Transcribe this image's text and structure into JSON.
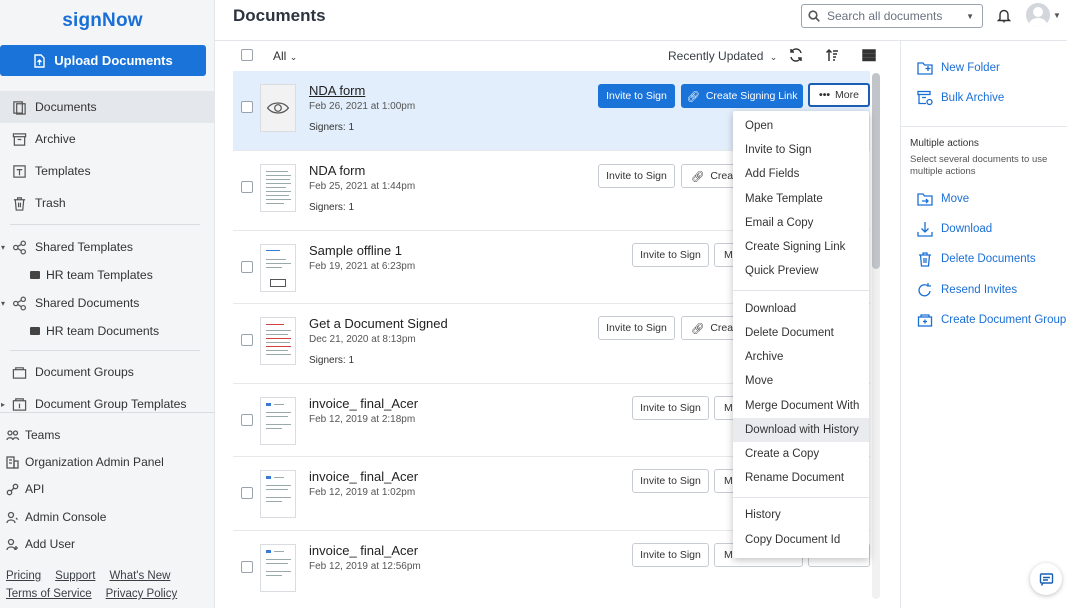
{
  "app": {
    "logo": "signNow",
    "page_title": "Documents"
  },
  "sidebar": {
    "upload_label": "Upload Documents",
    "items": [
      {
        "label": "Documents",
        "icon": "documents-icon",
        "active": true
      },
      {
        "label": "Archive",
        "icon": "archive-icon"
      },
      {
        "label": "Templates",
        "icon": "template-icon"
      },
      {
        "label": "Trash",
        "icon": "trash-icon"
      },
      {
        "label": "Shared Templates",
        "icon": "share-icon"
      },
      {
        "label": "HR team Templates",
        "icon": "folder-icon"
      },
      {
        "label": "Shared Documents",
        "icon": "share-icon"
      },
      {
        "label": "HR team Documents",
        "icon": "folder-icon"
      },
      {
        "label": "Document Groups",
        "icon": "document-group-icon"
      },
      {
        "label": "Document Group Templates",
        "icon": "document-group-template-icon"
      }
    ],
    "links": [
      {
        "label": "Teams",
        "icon": "teams-icon"
      },
      {
        "label": "Organization Admin Panel",
        "icon": "organization-icon"
      },
      {
        "label": "API",
        "icon": "api-icon"
      },
      {
        "label": "Admin Console",
        "icon": "admin-icon"
      },
      {
        "label": "Add User",
        "icon": "add-user-icon"
      }
    ],
    "footer": [
      "Pricing",
      "Support",
      "What's New",
      "Terms of Service",
      "Privacy Policy"
    ]
  },
  "header": {
    "search_placeholder": "Search all documents"
  },
  "toolbar": {
    "filter_label": "All",
    "sort_label": "Recently Updated"
  },
  "documents": [
    {
      "name": "NDA form",
      "date": "Feb 26, 2021 at 1:00pm",
      "signers": "Signers: 1",
      "selected": true
    },
    {
      "name": "NDA form",
      "date": "Feb 25, 2021 at 1:44pm",
      "signers": "Signers: 1"
    },
    {
      "name": "Sample offline 1",
      "date": "Feb 19, 2021 at 6:23pm",
      "signers": ""
    },
    {
      "name": "Get a Document Signed",
      "date": "Dec 21, 2020 at 8:13pm",
      "signers": "Signers: 1"
    },
    {
      "name": "invoice_ final_Acer",
      "date": "Feb 12, 2019 at 2:18pm",
      "signers": ""
    },
    {
      "name": "invoice_ final_Acer",
      "date": "Feb 12, 2019 at 1:02pm",
      "signers": ""
    },
    {
      "name": "invoice_ final_Acer",
      "date": "Feb 12, 2019 at 12:56pm",
      "signers": ""
    }
  ],
  "row_buttons": {
    "invite": "Invite to Sign",
    "signing_link": "Create Signing Link",
    "signing_link_short": "Creat",
    "more": "More",
    "m": "M"
  },
  "context_menu": {
    "groups": [
      [
        "Open",
        "Invite to Sign",
        "Add Fields",
        "Make Template",
        "Email a Copy",
        "Create Signing Link",
        "Quick Preview"
      ],
      [
        "Download",
        "Delete Document",
        "Archive",
        "Move",
        "Merge Document With",
        "Download with History",
        "Create a Copy",
        "Rename Document"
      ],
      [
        "History",
        "Copy Document Id"
      ]
    ],
    "highlighted": "Download with History"
  },
  "right_panel": {
    "actions": [
      {
        "label": "New Folder",
        "icon": "new-folder-icon"
      },
      {
        "label": "Bulk Archive",
        "icon": "bulk-archive-icon"
      }
    ],
    "multiple_title": "Multiple actions",
    "multiple_subtitle": "Select several documents to use multiple actions",
    "multi_actions": [
      {
        "label": "Move",
        "icon": "move-icon"
      },
      {
        "label": "Download",
        "icon": "download-icon"
      },
      {
        "label": "Delete Documents",
        "icon": "delete-icon"
      },
      {
        "label": "Resend Invites",
        "icon": "resend-icon"
      },
      {
        "label": "Create Document Group",
        "icon": "document-group-icon"
      }
    ]
  },
  "colors": {
    "brand": "#1a73d9",
    "link": "#1a6fd6",
    "selected_row": "#e2eefb"
  }
}
